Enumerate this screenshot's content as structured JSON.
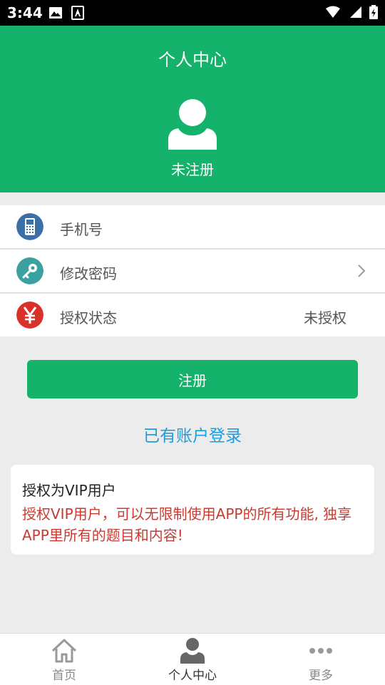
{
  "status_bar": {
    "time": "3:44"
  },
  "header": {
    "title": "个人中心",
    "user_status": "未注册"
  },
  "info_rows": [
    {
      "label": "手机号",
      "value": ""
    },
    {
      "label": "修改密码",
      "value": ""
    },
    {
      "label": "授权状态",
      "value": "未授权"
    }
  ],
  "actions": {
    "register_label": "注册",
    "login_link": "已有账户登录"
  },
  "vip": {
    "title": "授权为VIP用户",
    "description": "授权VIP用户，可以无限制使用APP的所有功能, 独享APP里所有的题目和内容!"
  },
  "bottom_nav": [
    {
      "label": "首页"
    },
    {
      "label": "个人中心"
    },
    {
      "label": "更多"
    }
  ],
  "colors": {
    "primary": "#14b26a",
    "link": "#1a9ee0",
    "vip_text": "#c93a30"
  }
}
